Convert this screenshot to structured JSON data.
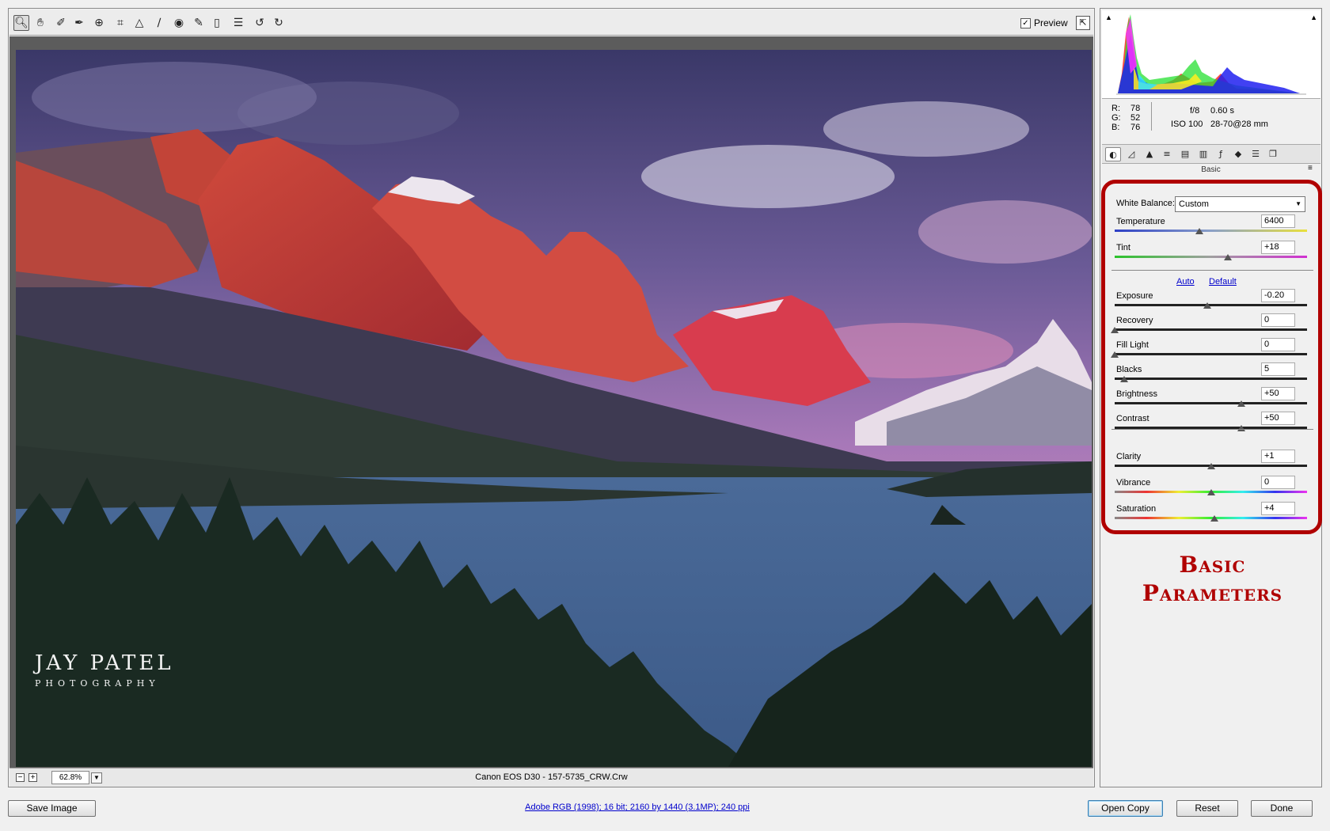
{
  "toolbar": {
    "tools": [
      "zoom-icon",
      "hand-icon",
      "white-balance-icon",
      "color-sampler-icon",
      "target-adjust-icon",
      "crop-icon",
      "straighten-icon",
      "spot-removal-icon",
      "red-eye-icon",
      "adjustment-brush-icon",
      "graduated-filter-icon",
      "preferences-icon",
      "rotate-left-icon",
      "rotate-right-icon"
    ],
    "preview_label": "Preview",
    "preview_checked": true
  },
  "photo": {
    "watermark_name": "JAY PATEL",
    "watermark_sub": "PHOTOGRAPHY"
  },
  "status": {
    "zoom": "62.8%",
    "file_label": "Canon EOS D30  -  157-5735_CRW.Crw"
  },
  "info": {
    "r_label": "R:",
    "r": "78",
    "g_label": "G:",
    "g": "52",
    "b_label": "B:",
    "b": "76",
    "aperture": "f/8",
    "shutter": "0.60 s",
    "iso": "ISO 100",
    "lens": "28-70@28 mm"
  },
  "panel": {
    "title": "Basic",
    "white_balance_label": "White Balance:",
    "white_balance_value": "Custom",
    "auto_label": "Auto",
    "default_label": "Default",
    "sliders": [
      {
        "label": "Temperature",
        "value": "6400",
        "pos": 0.44
      },
      {
        "label": "Tint",
        "value": "+18",
        "pos": 0.59
      },
      {
        "label": "Exposure",
        "value": "-0.20",
        "pos": 0.48
      },
      {
        "label": "Recovery",
        "value": "0",
        "pos": 0.0
      },
      {
        "label": "Fill Light",
        "value": "0",
        "pos": 0.0
      },
      {
        "label": "Blacks",
        "value": "5",
        "pos": 0.05
      },
      {
        "label": "Brightness",
        "value": "+50",
        "pos": 0.66
      },
      {
        "label": "Contrast",
        "value": "+50",
        "pos": 0.66
      },
      {
        "label": "Clarity",
        "value": "+1",
        "pos": 0.5
      },
      {
        "label": "Vibrance",
        "value": "0",
        "pos": 0.5
      },
      {
        "label": "Saturation",
        "value": "+4",
        "pos": 0.52
      }
    ]
  },
  "annotation": {
    "line1": "Basic",
    "line2": "Parameters"
  },
  "bottom": {
    "save_label": "Save Image",
    "workflow": "Adobe RGB (1998); 16 bit; 2160 by 1440 (3.1MP); 240 ppi",
    "open_label": "Open Copy",
    "reset_label": "Reset",
    "done_label": "Done"
  }
}
